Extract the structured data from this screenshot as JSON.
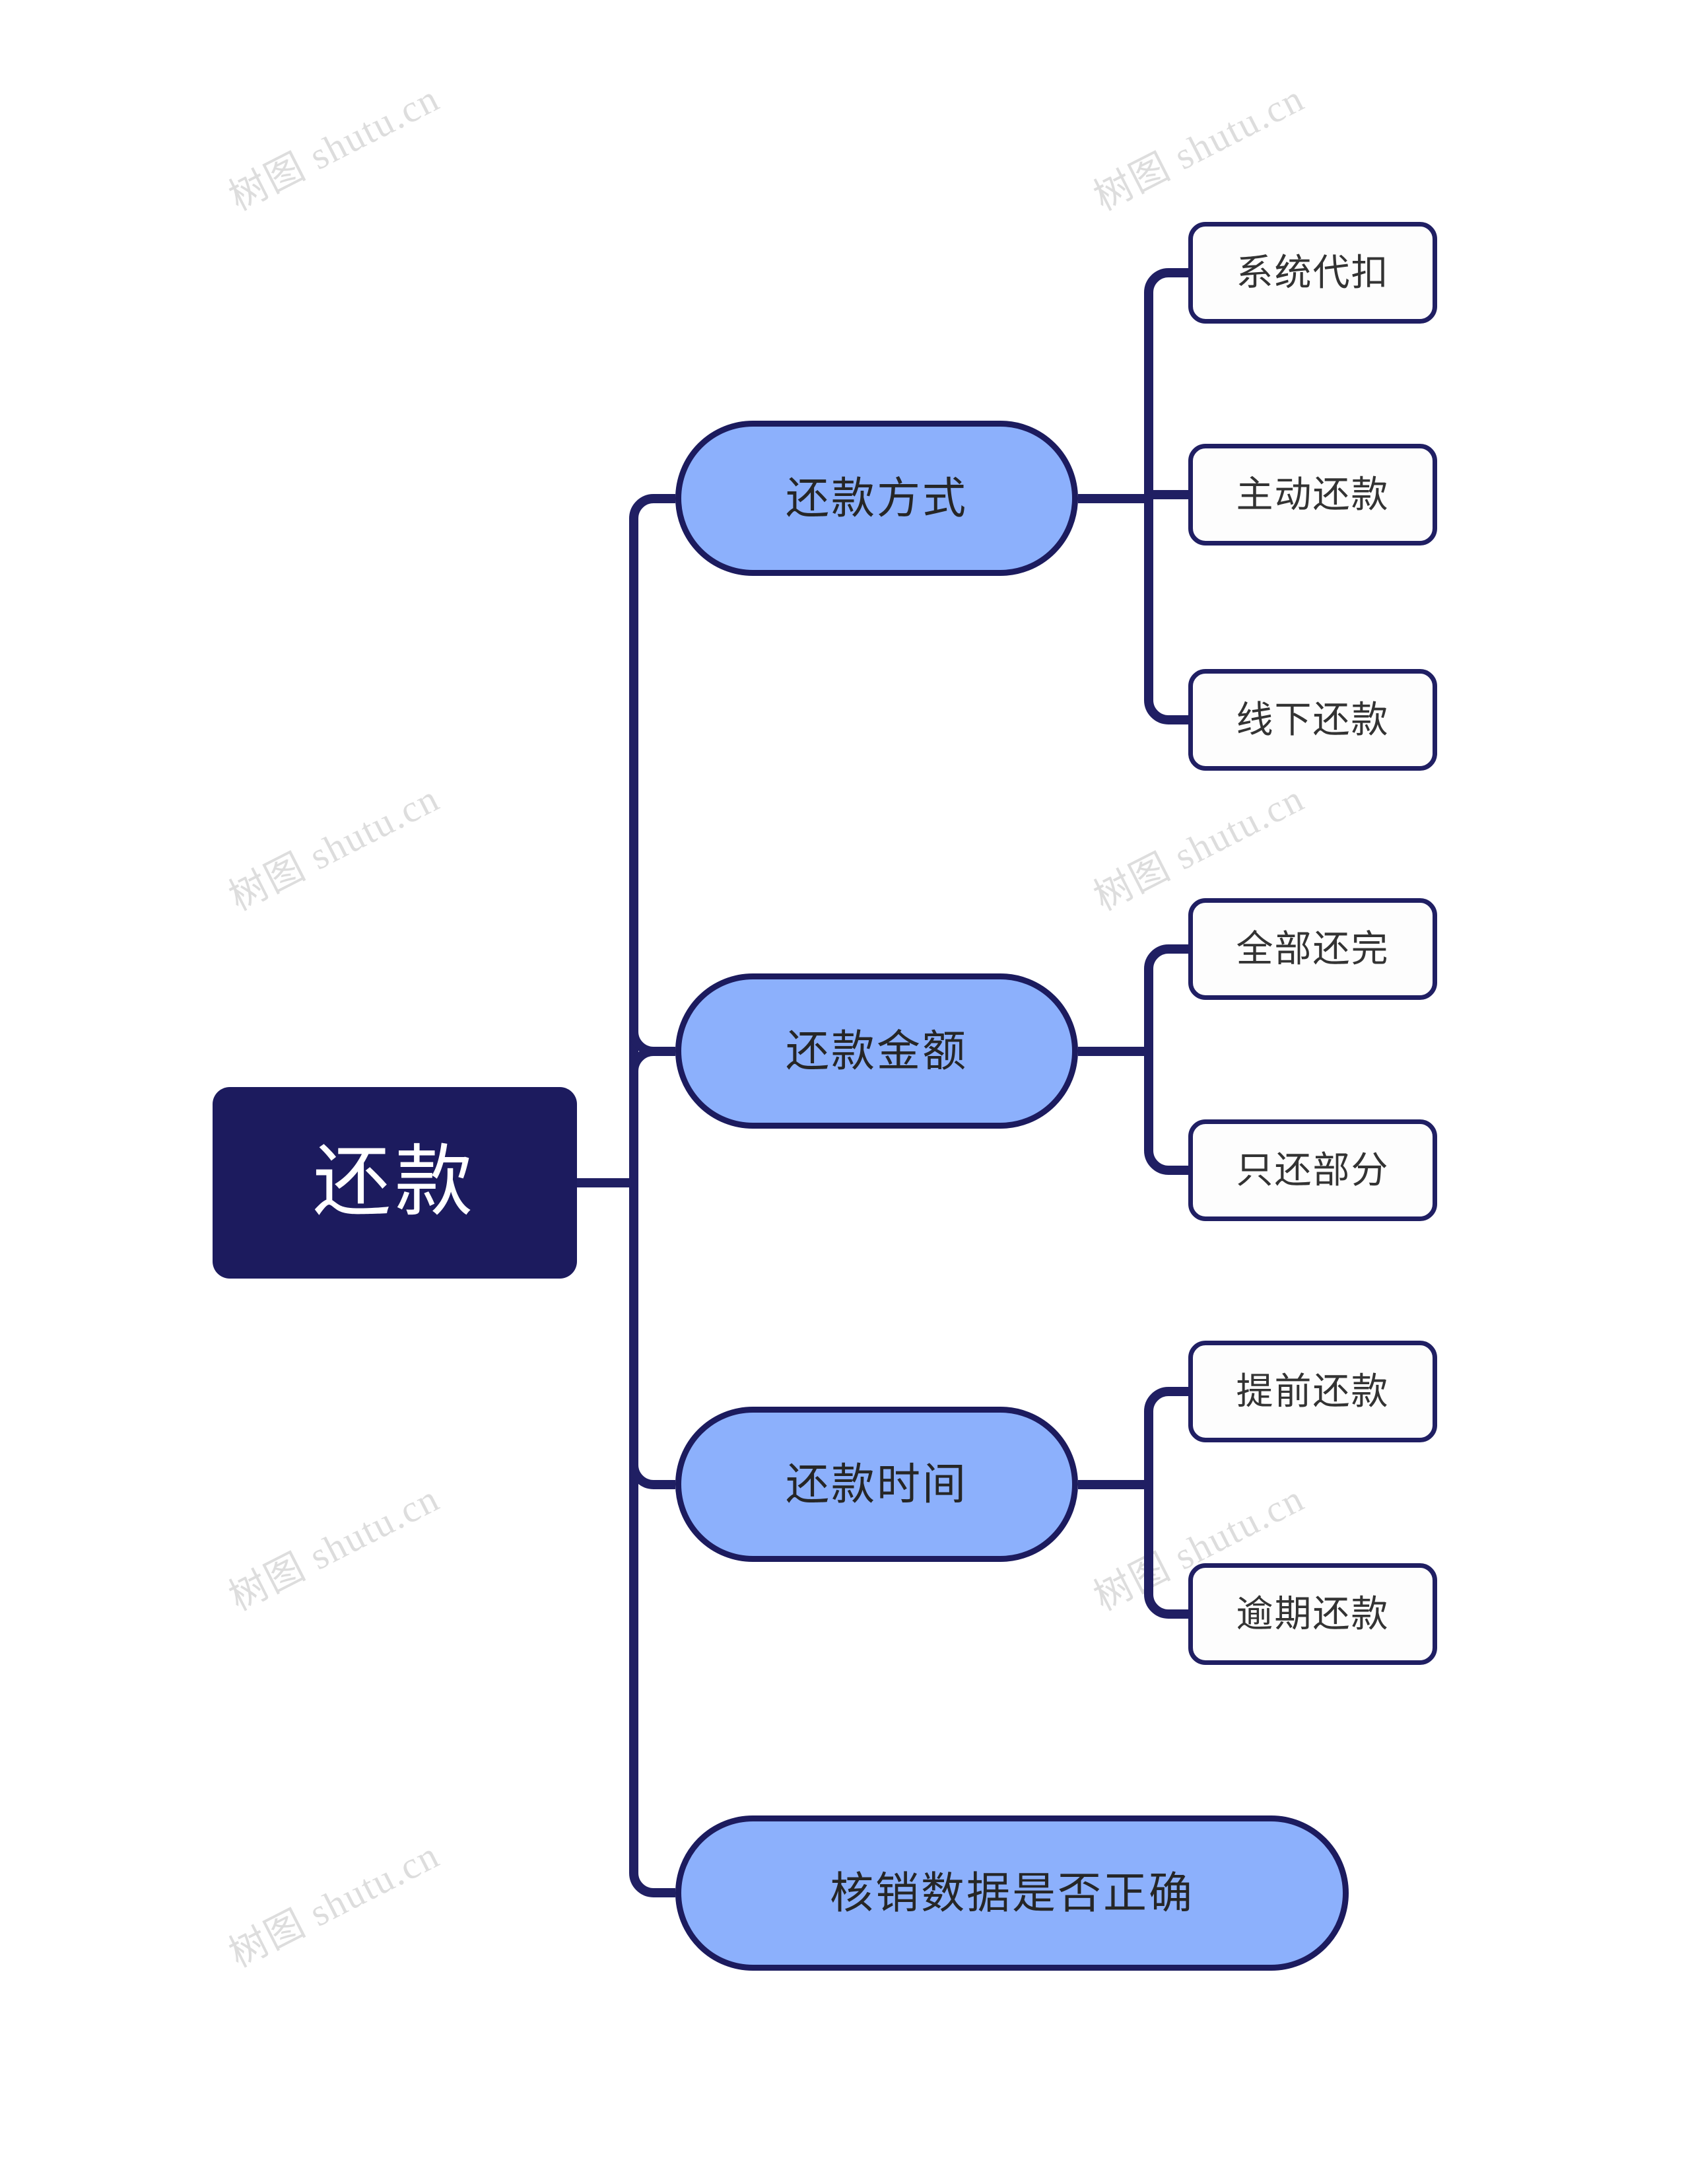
{
  "theme": {
    "background": "#ffffff",
    "root_fill": "#1c1b5e",
    "root_text": "#ffffff",
    "branch_fill": "#8cb0fc",
    "branch_text": "#262626",
    "leaf_fill": "#fdfdfd",
    "leaf_text": "#333333",
    "line_color": "#201f63",
    "watermark_color": "#dcdcdc"
  },
  "watermark": {
    "text": "树图 shutu.cn",
    "rotation_deg": -27
  },
  "mindmap": {
    "type": "mindmap",
    "direction": "left-to-right",
    "root": {
      "label": "还款"
    },
    "branches": [
      {
        "label": "还款方式",
        "children": [
          {
            "label": "系统代扣"
          },
          {
            "label": "主动还款"
          },
          {
            "label": "线下还款"
          }
        ]
      },
      {
        "label": "还款金额",
        "children": [
          {
            "label": "全部还完"
          },
          {
            "label": "只还部分"
          }
        ]
      },
      {
        "label": "还款时间",
        "children": [
          {
            "label": "提前还款"
          },
          {
            "label": "逾期还款"
          }
        ]
      },
      {
        "label": "核销数据是否正确",
        "children": []
      }
    ]
  }
}
